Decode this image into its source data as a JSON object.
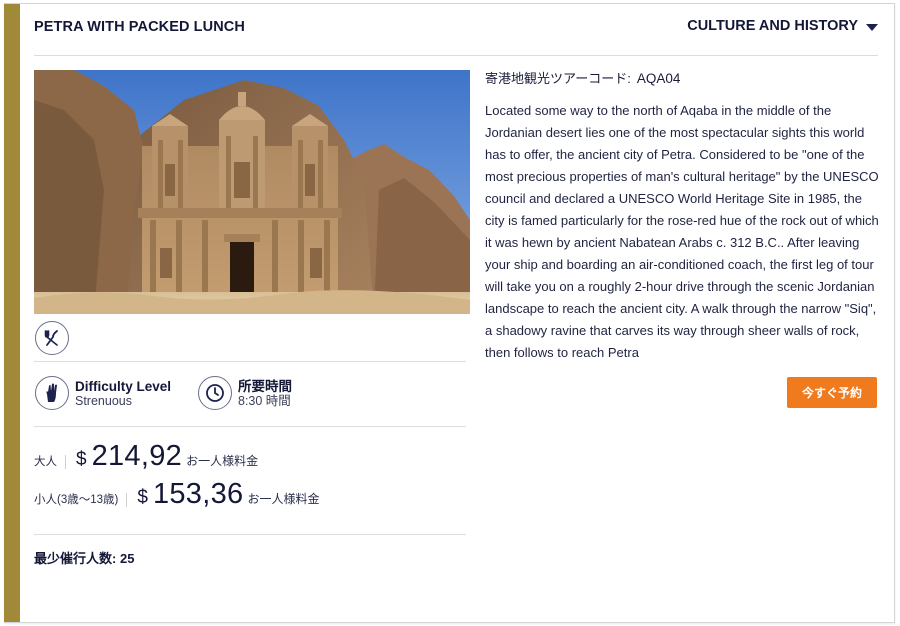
{
  "tour": {
    "title": "PETRA WITH PACKED LUNCH",
    "category": "CULTURE AND HISTORY",
    "code_label": "寄港地観光ツアーコード:",
    "code": "AQA04",
    "description": "Located some way to the north of Aqaba in the middle of the Jordanian desert lies one of the most spectacular sights this world has to offer, the ancient city of Petra. Considered to be \"one of the most precious properties of man's cultural heritage\" by the UNESCO council and declared a UNESCO World Heritage Site in 1985, the city is famed particularly for the rose-red hue of the rock out of which it was hewn by ancient Nabatean Arabs c. 312 B.C.. After leaving your ship and boarding an air-conditioned coach, the first leg of tour will take you on a roughly 2-hour drive through the scenic Jordanian landscape to reach the ancient city. A walk through the narrow \"Siq\", a shadowy ravine that carves its way through sheer walls of rock, then follows to reach Petra",
    "book_label": "今すぐ予約"
  },
  "features": {
    "difficulty_title": "Difficulty Level",
    "difficulty_value": "Strenuous",
    "duration_title": "所要時間",
    "duration_value": "8:30 時間"
  },
  "prices": {
    "adult_label": "大人",
    "adult_currency": "$",
    "adult_amount": "214,92",
    "adult_suffix": "お一人様料金",
    "child_label": "小人(3歳～13歳)",
    "child_currency": "$",
    "child_amount": "153,36",
    "child_suffix": "お一人様料金"
  },
  "min_participants": {
    "label": "最少催行人数",
    "value": "25"
  },
  "icons": {
    "meal": "fork-knife-icon",
    "difficulty": "hand-icon",
    "duration": "clock-icon",
    "dropdown": "chevron-down-icon"
  },
  "colors": {
    "accent_bar": "#a08a3a",
    "book_button": "#f07a1e",
    "text_dark": "#141837"
  }
}
